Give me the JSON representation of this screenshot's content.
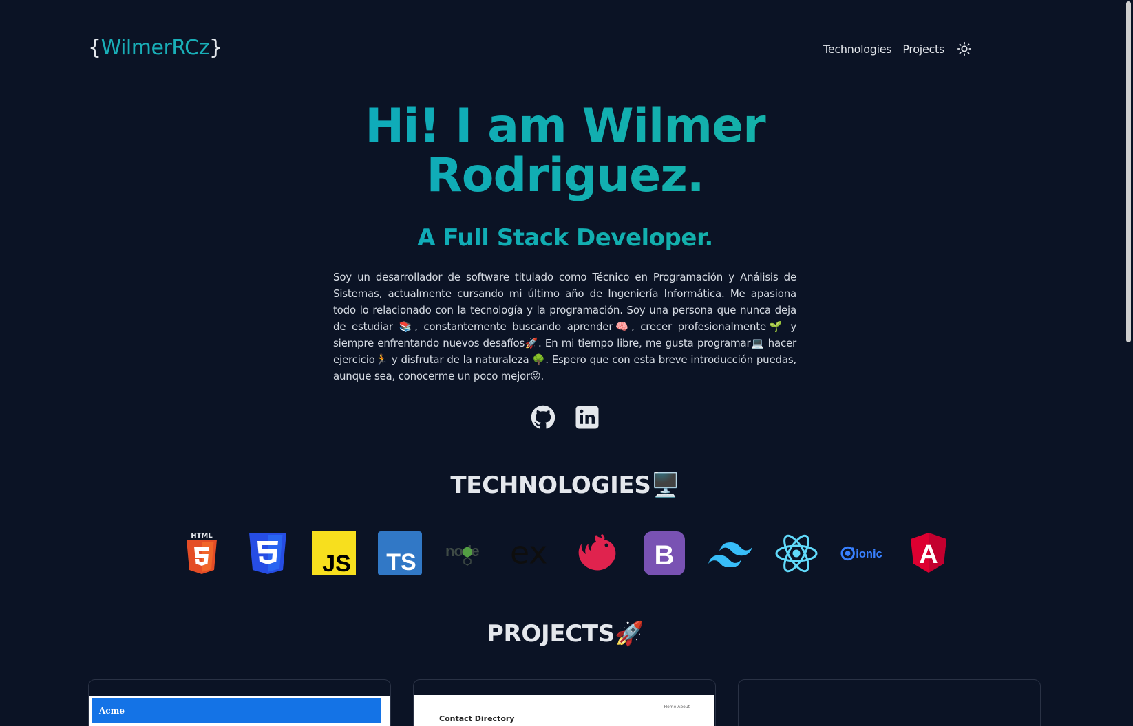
{
  "header": {
    "logo_open": "{",
    "logo_name": "WilmerRCz",
    "logo_close": "}",
    "nav": {
      "technologies": "Technologies",
      "projects": "Projects"
    },
    "theme_icon": "sun-icon"
  },
  "hero": {
    "title_line1": "Hi! I am Wilmer",
    "title_line2": "Rodriguez.",
    "subtitle": "A Full Stack Developer.",
    "bio": "Soy un desarrollador de software titulado como Técnico en Programación y Análisis de Sistemas, actualmente cursando mi último año de Ingeniería Informática. Me apasiona todo lo relacionado con la tecnología y la programación. Soy una persona que nunca deja de estudiar 📚, constantemente buscando aprender🧠, crecer profesionalmente🌱 y siempre enfrentando nuevos desafíos🚀. En mi tiempo libre, me gusta programar💻 hacer ejercicio🏃 y disfrutar de la naturaleza 🌳. Espero que con esta breve introducción puedas, aunque sea, conocerme un poco mejor😜."
  },
  "socials": [
    "github-icon",
    "linkedin-icon"
  ],
  "technologies": {
    "title": "TECHNOLOGIES",
    "emoji": "🖥️",
    "items": [
      {
        "icon": "html5-icon",
        "label": "HTML"
      },
      {
        "icon": "css3-icon",
        "label": "3"
      },
      {
        "icon": "javascript-icon",
        "label": "JS"
      },
      {
        "icon": "typescript-icon",
        "label": "TS"
      },
      {
        "icon": "nodejs-icon",
        "label": "node"
      },
      {
        "icon": "express-icon",
        "label": "ex"
      },
      {
        "icon": "nestjs-icon",
        "label": ""
      },
      {
        "icon": "bootstrap-icon",
        "label": "B"
      },
      {
        "icon": "tailwind-icon",
        "label": ""
      },
      {
        "icon": "react-icon",
        "label": ""
      },
      {
        "icon": "ionic-icon",
        "label": "ionic"
      },
      {
        "icon": "angular-icon",
        "label": "A"
      }
    ]
  },
  "projects": {
    "title": "PROJECTS",
    "emoji": "🚀",
    "cards": [
      {
        "preview_label": "Acme"
      },
      {
        "preview_label": "Contact Directory",
        "preview_nav": "Home   About"
      },
      {
        "preview_label": ""
      }
    ]
  },
  "colors": {
    "background": "#0b1325",
    "accent_start": "#0aa6c9",
    "accent_end": "#19b69a"
  }
}
